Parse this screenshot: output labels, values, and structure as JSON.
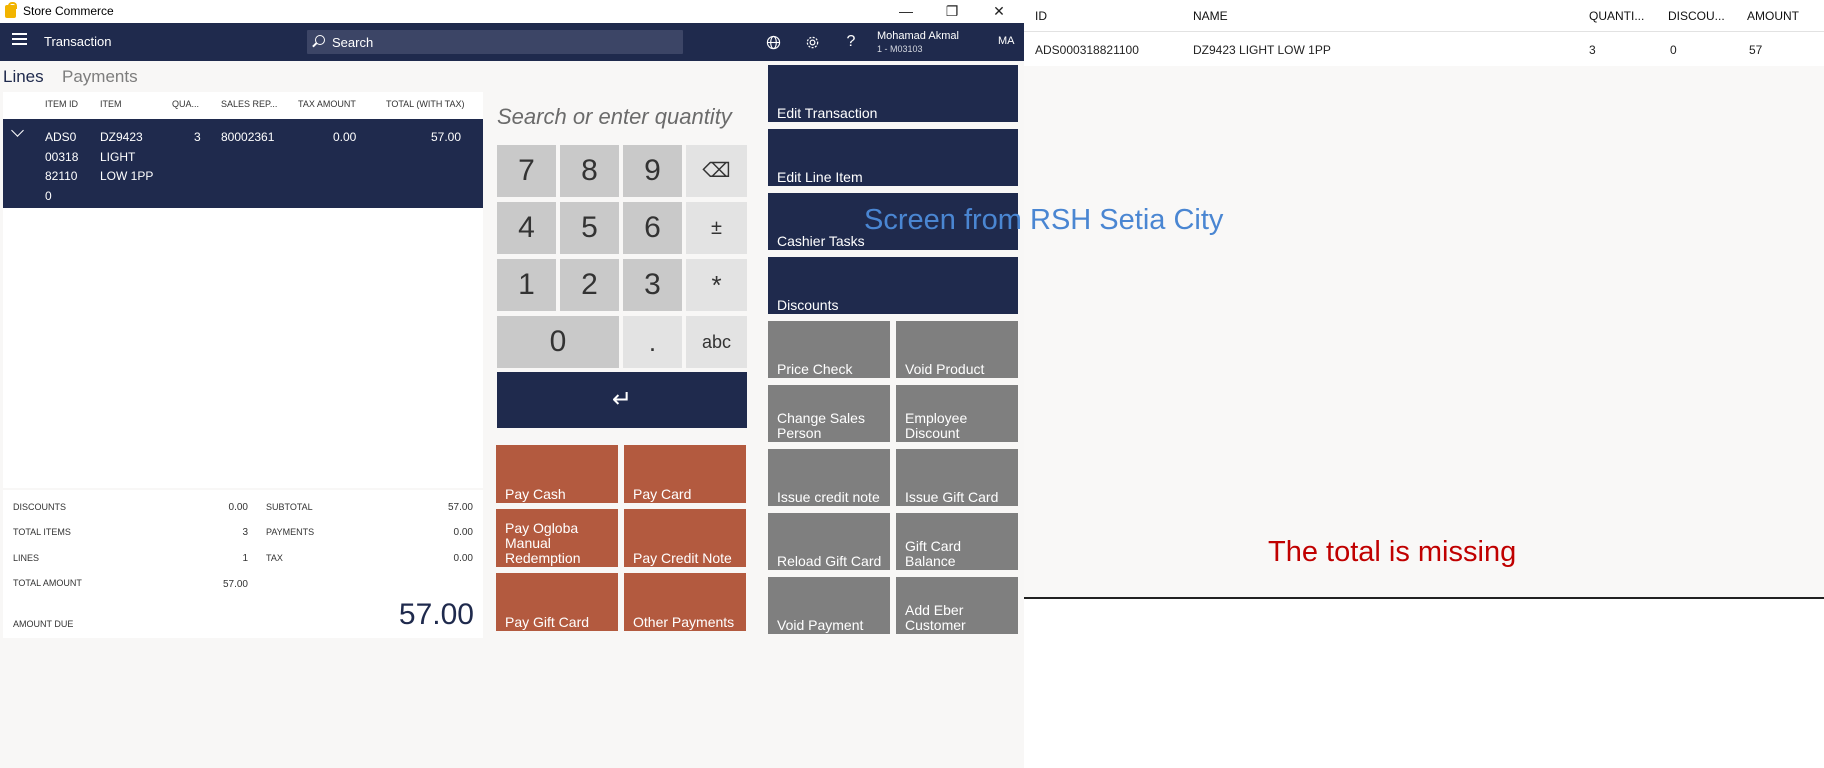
{
  "window": {
    "app_title": "Store Commerce",
    "minimize": "—",
    "restore": "❐",
    "close": "✕"
  },
  "nav": {
    "title": "Transaction",
    "search_placeholder": "Search",
    "user_name": "Mohamad Akmal",
    "user_sub": "1 - M03103",
    "user_initials": "MA",
    "help": "?"
  },
  "tabs": {
    "lines": "Lines",
    "payments": "Payments"
  },
  "lines": {
    "headers": [
      "ITEM ID",
      "ITEM",
      "QUA...",
      "SALES REP...",
      "TAX AMOUNT",
      "TOTAL (WITH TAX)"
    ],
    "row": {
      "item_id": "ADS0\n00318\n82110\n0",
      "item": "DZ9423\nLIGHT\nLOW 1PP",
      "quantity": "3",
      "sales_rep": "80002361",
      "tax_amount": "0.00",
      "total": "57.00"
    }
  },
  "totals": {
    "discounts_label": "DISCOUNTS",
    "discounts": "0.00",
    "total_items_label": "TOTAL ITEMS",
    "total_items": "3",
    "lines_label": "LINES",
    "lines": "1",
    "total_amount_label": "TOTAL AMOUNT",
    "total_amount": "57.00",
    "subtotal_label": "SUBTOTAL",
    "subtotal": "57.00",
    "payments_label": "PAYMENTS",
    "payments": "0.00",
    "tax_label": "TAX",
    "tax": "0.00",
    "amount_due_label": "AMOUNT DUE",
    "amount_due": "57.00"
  },
  "numpad": {
    "placeholder": "Search or enter quantity",
    "k7": "7",
    "k8": "8",
    "k9": "9",
    "backspace": "⌫",
    "k4": "4",
    "k5": "5",
    "k6": "6",
    "plusminus": "±",
    "k1": "1",
    "k2": "2",
    "k3": "3",
    "multiply": "*",
    "k0": "0",
    "dot": ".",
    "abc": "abc",
    "enter": "↵"
  },
  "payments": {
    "pay_cash": "Pay Cash",
    "pay_card": "Pay Card",
    "pay_ogloba": "Pay Ogloba Manual Redemption",
    "pay_credit_note": "Pay Credit Note",
    "pay_gift_card": "Pay Gift Card",
    "other_payments": "Other Payments"
  },
  "actions": {
    "edit_transaction": "Edit Transaction",
    "edit_line_item": "Edit Line Item",
    "cashier_tasks": "Cashier Tasks",
    "discounts": "Discounts",
    "price_check": "Price Check",
    "void_product": "Void Product",
    "change_sales_person": "Change Sales Person",
    "employee_discount": "Employee Discount",
    "issue_credit_note": "Issue credit note",
    "issue_gift_card": "Issue Gift Card",
    "reload_gift_card": "Reload Gift Card",
    "gift_card_balance": "Gift Card Balance",
    "void_payment": "Void Payment",
    "add_eber_customer": "Add Eber Customer"
  },
  "annotations": {
    "screen_note": "Screen from RSH Setia City",
    "total_missing": "The total is missing"
  },
  "receipt_grid": {
    "headers": [
      "ID",
      "NAME",
      "QUANTI...",
      "DISCOU...",
      "AMOUNT"
    ],
    "row": [
      "ADS000318821100",
      "DZ9423 LIGHT LOW 1PP",
      "3",
      "0",
      "57"
    ]
  },
  "colors": {
    "navy": "#1f2a4d",
    "pay": "#b35a3f",
    "gray_btn": "#7f7f7f",
    "note_blue": "#4a86d2",
    "note_red": "#c00000"
  }
}
